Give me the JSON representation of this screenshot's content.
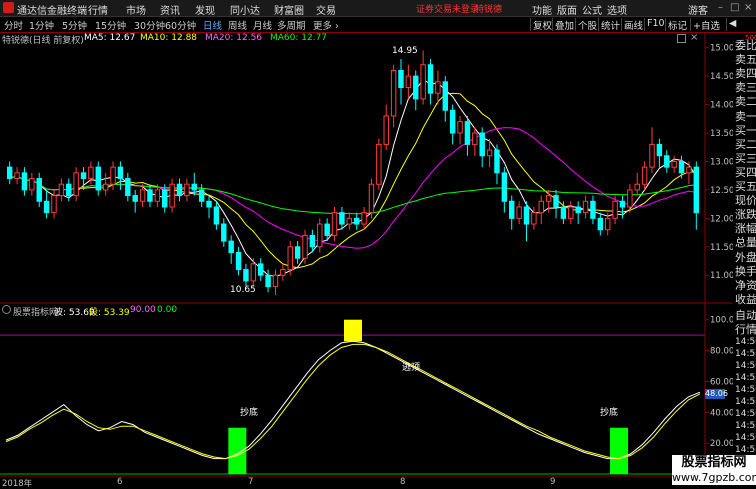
{
  "app": {
    "title": "通达信金融终端",
    "menu": [
      "行情",
      "市场",
      "资讯",
      "发现",
      "同小达",
      "财富圈",
      "交易"
    ],
    "notice": "证券交易未登录",
    "stock_name": "特锐德",
    "right_menu": [
      "功能",
      "版面",
      "公式",
      "选项"
    ],
    "guest": "游客"
  },
  "toolbar": {
    "tabs": [
      "分时",
      "1分钟",
      "5分钟",
      "15分钟",
      "30分钟",
      "60分钟",
      "日线",
      "周线",
      "月线",
      "多周期",
      "更多 ›"
    ],
    "active_tab": "日线",
    "right_tabs": [
      "复权",
      "叠加",
      "个股",
      "统计",
      "画线",
      "F10",
      "标记",
      "+自选",
      "◀"
    ]
  },
  "chart_info": {
    "title": "特锐德(日线 前复权)",
    "ma5": "MA5: 12.67",
    "ma10": "MA10: 12.88",
    "ma20": "MA20: 12.56",
    "ma60": "MA60: 12.77",
    "colors": {
      "ma5": "#ffffff",
      "ma10": "#ffff00",
      "ma20": "#ff00ff",
      "ma60": "#00ff00",
      "up": "#ff3b3b",
      "down": "#00ffff"
    }
  },
  "quote_panel": {
    "labels": [
      "委比",
      "卖五",
      "卖四",
      "卖三",
      "卖二",
      "卖一",
      "买一",
      "买二",
      "买三",
      "买四",
      "买五",
      "现价",
      "涨跌",
      "涨幅",
      "总量",
      "外盘",
      "换手",
      "净资",
      "收益"
    ],
    "mini": "500",
    "lower_labels": [
      "自动",
      "行情"
    ],
    "times": [
      "14:50",
      "14:50",
      "14:50",
      "14:50",
      "14:50",
      "14:50",
      "14:50",
      "14:50",
      "14:50",
      "14:50",
      "14:50",
      "14:50"
    ]
  },
  "chart_data": [
    {
      "type": "candlestick",
      "title": "特锐德(日线 前复权)",
      "y_ticks": [
        "15.00",
        "14.50",
        "14.00",
        "13.50",
        "13.00",
        "12.50",
        "12.00",
        "11.50",
        "11.00"
      ],
      "ylim": [
        10.6,
        15.1
      ],
      "annotations": {
        "high": "14.95",
        "low": "10.65"
      },
      "candles": [
        [
          12.9,
          12.7,
          13.0,
          12.6
        ],
        [
          12.7,
          12.8,
          12.9,
          12.6
        ],
        [
          12.8,
          12.5,
          12.9,
          12.4
        ],
        [
          12.5,
          12.7,
          12.8,
          12.4
        ],
        [
          12.7,
          12.3,
          12.8,
          12.2
        ],
        [
          12.3,
          12.1,
          12.5,
          12.0
        ],
        [
          12.1,
          12.4,
          12.5,
          12.0
        ],
        [
          12.4,
          12.6,
          12.7,
          12.3
        ],
        [
          12.6,
          12.4,
          12.7,
          12.3
        ],
        [
          12.4,
          12.8,
          12.9,
          12.3
        ],
        [
          12.8,
          12.7,
          12.9,
          12.5
        ],
        [
          12.7,
          12.9,
          13.0,
          12.6
        ],
        [
          12.9,
          12.5,
          13.0,
          12.4
        ],
        [
          12.5,
          12.6,
          12.8,
          12.4
        ],
        [
          12.6,
          12.9,
          13.0,
          12.5
        ],
        [
          12.9,
          12.7,
          13.0,
          12.5
        ],
        [
          12.7,
          12.4,
          12.8,
          12.3
        ],
        [
          12.4,
          12.3,
          12.5,
          12.1
        ],
        [
          12.3,
          12.5,
          12.6,
          12.2
        ],
        [
          12.5,
          12.3,
          12.6,
          12.2
        ],
        [
          12.3,
          12.5,
          12.6,
          12.2
        ],
        [
          12.5,
          12.2,
          12.6,
          12.1
        ],
        [
          12.2,
          12.6,
          12.7,
          12.1
        ],
        [
          12.6,
          12.4,
          12.7,
          12.3
        ],
        [
          12.4,
          12.6,
          12.7,
          12.3
        ],
        [
          12.6,
          12.5,
          12.8,
          12.4
        ],
        [
          12.5,
          12.3,
          12.6,
          12.2
        ],
        [
          12.3,
          12.2,
          12.4,
          12.0
        ],
        [
          12.2,
          11.9,
          12.3,
          11.8
        ],
        [
          11.9,
          11.6,
          12.0,
          11.5
        ],
        [
          11.6,
          11.4,
          11.7,
          11.2
        ],
        [
          11.4,
          11.1,
          11.5,
          11.0
        ],
        [
          11.1,
          10.9,
          11.2,
          10.8
        ],
        [
          10.9,
          11.2,
          11.3,
          10.8
        ],
        [
          11.2,
          11.0,
          11.3,
          10.9
        ],
        [
          11.0,
          10.8,
          11.1,
          10.7
        ],
        [
          10.8,
          11.0,
          11.1,
          10.65
        ],
        [
          11.0,
          11.1,
          11.2,
          10.9
        ],
        [
          11.1,
          11.5,
          11.6,
          11.0
        ],
        [
          11.5,
          11.3,
          11.6,
          11.2
        ],
        [
          11.3,
          11.7,
          11.8,
          11.2
        ],
        [
          11.7,
          11.5,
          11.8,
          11.4
        ],
        [
          11.5,
          11.9,
          12.0,
          11.4
        ],
        [
          11.9,
          11.7,
          12.0,
          11.6
        ],
        [
          11.7,
          12.1,
          12.2,
          11.6
        ],
        [
          12.1,
          11.9,
          12.2,
          11.8
        ],
        [
          11.9,
          12.0,
          12.1,
          11.8
        ],
        [
          12.0,
          11.9,
          12.1,
          11.8
        ],
        [
          11.9,
          12.1,
          12.2,
          11.8
        ],
        [
          12.1,
          12.6,
          12.7,
          12.0
        ],
        [
          12.6,
          13.3,
          13.4,
          12.5
        ],
        [
          13.3,
          13.8,
          14.0,
          13.2
        ],
        [
          13.8,
          14.6,
          14.7,
          13.6
        ],
        [
          14.6,
          14.3,
          14.8,
          14.0
        ],
        [
          14.3,
          14.5,
          14.7,
          14.1
        ],
        [
          14.5,
          14.1,
          14.6,
          13.9
        ],
        [
          14.1,
          14.7,
          14.95,
          14.0
        ],
        [
          14.7,
          14.2,
          14.8,
          14.0
        ],
        [
          14.2,
          14.4,
          14.6,
          14.0
        ],
        [
          14.4,
          13.9,
          14.5,
          13.7
        ],
        [
          13.9,
          13.5,
          14.0,
          13.3
        ],
        [
          13.5,
          13.7,
          13.8,
          13.3
        ],
        [
          13.7,
          13.3,
          13.8,
          13.1
        ],
        [
          13.3,
          13.5,
          13.6,
          13.1
        ],
        [
          13.5,
          13.1,
          13.6,
          12.9
        ],
        [
          13.1,
          13.2,
          13.4,
          12.9
        ],
        [
          13.2,
          12.8,
          13.3,
          12.6
        ],
        [
          12.8,
          12.3,
          12.9,
          12.1
        ],
        [
          12.3,
          12.0,
          12.4,
          11.8
        ],
        [
          12.0,
          12.2,
          12.3,
          11.9
        ],
        [
          12.2,
          11.9,
          12.3,
          11.6
        ],
        [
          11.9,
          12.1,
          12.2,
          11.8
        ],
        [
          12.1,
          12.3,
          12.4,
          11.9
        ],
        [
          12.3,
          12.4,
          12.5,
          12.1
        ],
        [
          12.4,
          12.2,
          12.5,
          12.0
        ],
        [
          12.2,
          12.0,
          12.3,
          11.9
        ],
        [
          12.0,
          12.2,
          12.3,
          11.9
        ],
        [
          12.2,
          12.1,
          12.3,
          11.9
        ],
        [
          12.1,
          12.3,
          12.4,
          12.0
        ],
        [
          12.3,
          12.0,
          12.4,
          11.9
        ],
        [
          12.0,
          11.8,
          12.1,
          11.7
        ],
        [
          11.8,
          12.0,
          12.1,
          11.7
        ],
        [
          12.0,
          12.3,
          12.4,
          11.9
        ],
        [
          12.3,
          12.2,
          12.4,
          12.0
        ],
        [
          12.2,
          12.5,
          12.6,
          12.1
        ],
        [
          12.5,
          12.6,
          12.8,
          12.4
        ],
        [
          12.6,
          12.9,
          13.0,
          12.5
        ],
        [
          12.9,
          13.3,
          13.6,
          12.8
        ],
        [
          13.3,
          13.1,
          13.4,
          12.9
        ],
        [
          13.1,
          12.9,
          13.2,
          12.8
        ],
        [
          12.9,
          13.0,
          13.1,
          12.8
        ],
        [
          13.0,
          12.8,
          13.1,
          12.7
        ],
        [
          12.8,
          12.9,
          13.0,
          12.6
        ],
        [
          12.9,
          12.1,
          13.0,
          11.8
        ]
      ],
      "series": [
        {
          "name": "MA5",
          "color": "#ffffff"
        },
        {
          "name": "MA10",
          "color": "#ffff00"
        },
        {
          "name": "MA20",
          "color": "#ff00ff"
        },
        {
          "name": "MA60",
          "color": "#00ff00"
        }
      ]
    },
    {
      "type": "line",
      "title": "股票指标网",
      "legend": [
        "波: 53.69",
        "段: 53.39",
        "90.00",
        "0.00"
      ],
      "y_ticks": [
        "100.00",
        "80.00",
        "60.00",
        "40.00",
        "20.00"
      ],
      "ylim": [
        0,
        105
      ],
      "hline": 90,
      "last_value": "48.06",
      "series": [
        {
          "name": "波",
          "color": "#ffffff",
          "values": [
            22,
            25,
            30,
            35,
            40,
            45,
            38,
            32,
            28,
            30,
            34,
            32,
            27,
            24,
            21,
            18,
            15,
            12,
            10,
            10,
            13,
            18,
            26,
            35,
            45,
            55,
            65,
            74,
            80,
            85,
            86,
            85,
            82,
            78,
            74,
            70,
            66,
            62,
            58,
            54,
            50,
            46,
            42,
            38,
            34,
            30,
            26,
            23,
            20,
            17,
            14,
            12,
            10,
            10,
            13,
            19,
            27,
            36,
            44,
            50,
            53
          ]
        },
        {
          "name": "段",
          "color": "#ffff00",
          "values": [
            21,
            24,
            29,
            33,
            38,
            42,
            39,
            34,
            30,
            29,
            31,
            31,
            28,
            25,
            22,
            19,
            16,
            13,
            11,
            10,
            12,
            16,
            23,
            31,
            41,
            51,
            61,
            70,
            77,
            82,
            84,
            84,
            82,
            79,
            75,
            71,
            67,
            63,
            59,
            55,
            51,
            47,
            43,
            39,
            35,
            31,
            28,
            24,
            21,
            18,
            15,
            13,
            11,
            10,
            12,
            17,
            24,
            33,
            41,
            48,
            52
          ]
        }
      ],
      "signals": [
        {
          "label": "抄底",
          "index": 20,
          "value": 12,
          "color": "#00ff00"
        },
        {
          "label": "逃顶",
          "index": 30,
          "value": 86,
          "color": "#ffff00"
        },
        {
          "label": "抄底",
          "index": 53,
          "value": 12,
          "color": "#00ff00"
        }
      ]
    }
  ],
  "indicator_info": {
    "name": "股票指标网",
    "bo": "波: 53.69",
    "duan": "段: 53.39",
    "upper": "90.00",
    "lower": "0.00"
  },
  "date_axis": [
    "2018年",
    "6",
    "7",
    "8",
    "9"
  ],
  "watermark": {
    "line1": "股票指标网",
    "line2": "www.7gpzb.com"
  }
}
